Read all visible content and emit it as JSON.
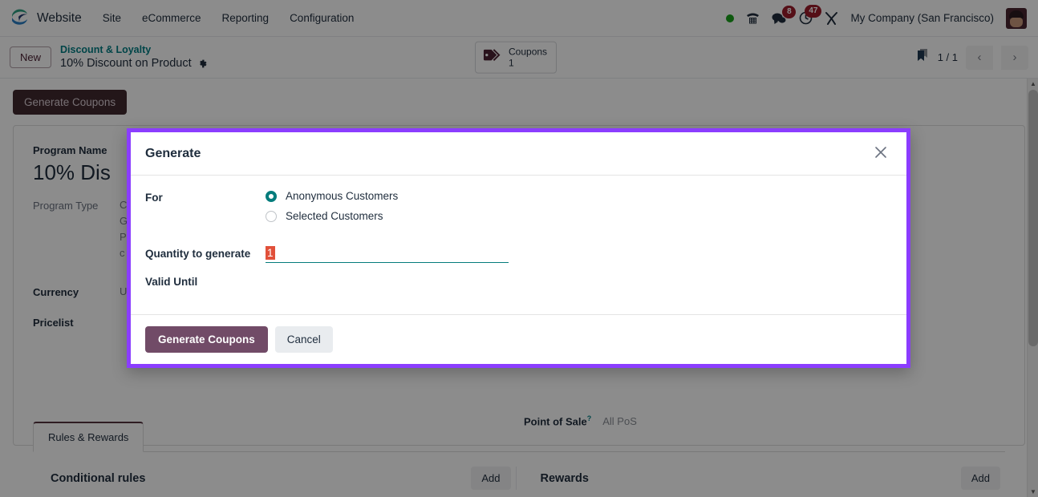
{
  "navbar": {
    "brand": "Website",
    "menu": [
      "Site",
      "eCommerce",
      "Reporting",
      "Configuration"
    ],
    "status_dot": "online",
    "icons": [
      {
        "name": "phone-icon",
        "badge": ""
      },
      {
        "name": "messages-icon",
        "badge": "8"
      },
      {
        "name": "activities-icon",
        "badge": "47"
      },
      {
        "name": "debug-tools-icon",
        "badge": ""
      }
    ],
    "company": "My Company (San Francisco)",
    "avatar": "user-avatar"
  },
  "control_panel": {
    "new_label": "New",
    "breadcrumb_parent": "Discount & Loyalty",
    "breadcrumb_current": "10% Discount on Product",
    "settings_icon": "gear-icon",
    "stat_button": {
      "icon": "tag-icon",
      "label": "Coupons",
      "value": "1"
    },
    "bookmark_icon": "bookmark-icon",
    "pager": "1 / 1",
    "prev": "‹",
    "next": "›"
  },
  "page": {
    "generate_coupons_button": "Generate Coupons",
    "fields": [
      {
        "label": "Program Name",
        "value": "10% Dis",
        "type": "title"
      },
      {
        "label": "Program Type",
        "value": "C\nG\nP\nc",
        "type": "multiline"
      },
      {
        "label": "Currency",
        "value": "U",
        "type": "text"
      },
      {
        "label": "Pricelist",
        "value": "",
        "type": "text"
      }
    ],
    "pos_label": "Point of Sale",
    "pos_help": "?",
    "pos_value": "All PoS",
    "notebook": {
      "tabs": [
        "Rules & Rewards"
      ],
      "left_heading": "Conditional rules",
      "left_add": "Add",
      "right_heading": "Rewards",
      "right_add": "Add"
    }
  },
  "modal": {
    "title": "Generate",
    "close_icon": "close-icon",
    "for_label": "For",
    "options": [
      {
        "label": "Anonymous Customers",
        "selected": true
      },
      {
        "label": "Selected Customers",
        "selected": false
      }
    ],
    "quantity_label": "Quantity to generate",
    "quantity_value": "1",
    "valid_until_label": "Valid Until",
    "valid_until_value": "",
    "confirm_label": "Generate Coupons",
    "cancel_label": "Cancel"
  },
  "colors": {
    "primary": "#714b67",
    "accent_teal": "#017e84",
    "dialog_border": "#8b3dff",
    "selection": "#e1503a",
    "badge": "#9b1c2b"
  }
}
